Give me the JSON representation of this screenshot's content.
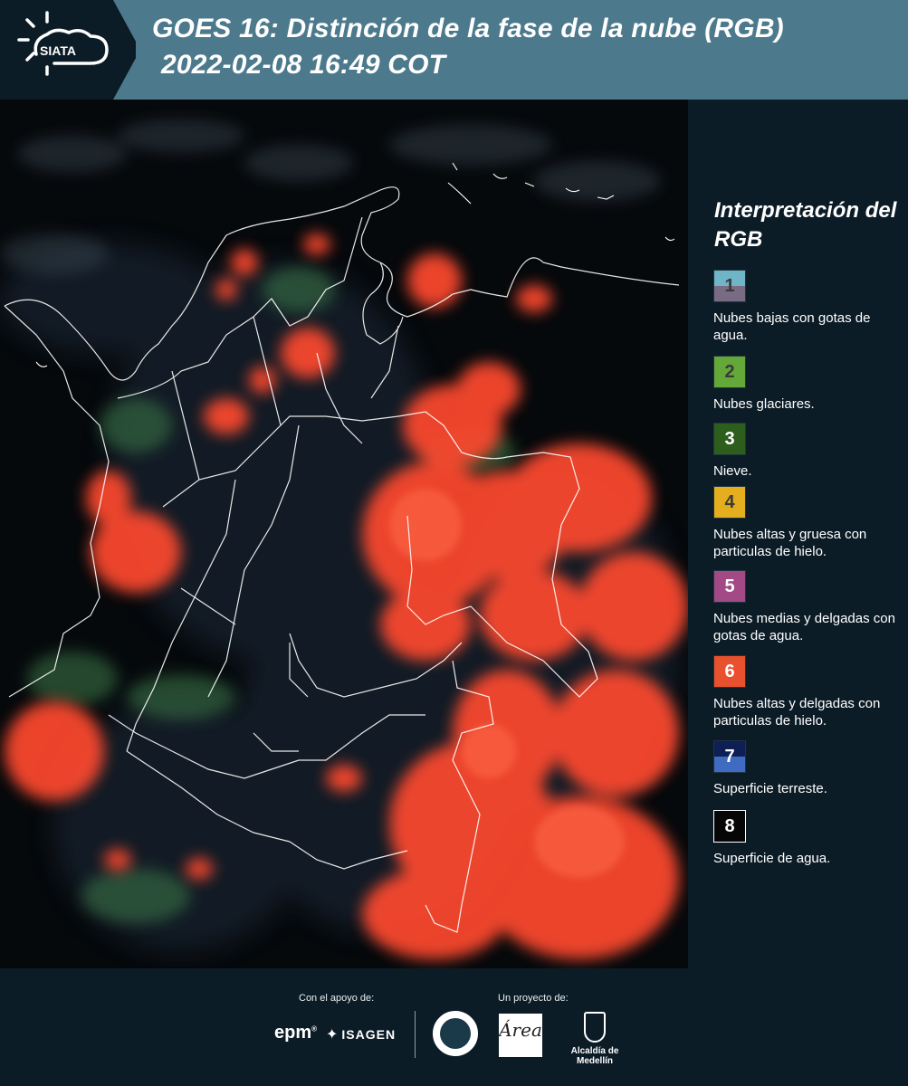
{
  "header": {
    "logo_text": "SIATA",
    "title_line1": "GOES 16: Distinción de la fase de la nube (RGB)",
    "title_line2": "2022-02-08 16:49 COT"
  },
  "legend": {
    "title": "Interpretación del RGB",
    "items": [
      {
        "number": "1",
        "label": "Nubes bajas con gotas de agua.",
        "color_top": "#6fb5c7",
        "color_bottom": "#7a6b85",
        "num_color": "#3a3a3a"
      },
      {
        "number": "2",
        "label": "Nubes glaciares.",
        "color_top": "#65a83a",
        "color_bottom": "#65a83a",
        "num_color": "#3a3a3a"
      },
      {
        "number": "3",
        "label": "Nieve.",
        "color_top": "#2d5e1e",
        "color_bottom": "#2d5e1e",
        "num_color": "#ffffff"
      },
      {
        "number": "4",
        "label": "Nubes altas y gruesa con particulas de hielo.",
        "color_top": "#e4ae1e",
        "color_bottom": "#e4ae1e",
        "num_color": "#3a3a3a"
      },
      {
        "number": "5",
        "label": "Nubes medias y delgadas con gotas de agua.",
        "color_top": "#a34a86",
        "color_bottom": "#a34a86",
        "num_color": "#ffffff"
      },
      {
        "number": "6",
        "label": "Nubes altas y delgadas con particulas de hielo.",
        "color_top": "#e9512e",
        "color_bottom": "#e9512e",
        "num_color": "#ffffff"
      },
      {
        "number": "7",
        "label": "Superficie terreste.",
        "color_top": "#0d1f55",
        "color_bottom": "#3f6cc0",
        "num_color": "#ffffff"
      },
      {
        "number": "8",
        "label": "Superficie de agua.",
        "color_top": "#060606",
        "color_bottom": "#060606",
        "num_color": "#ffffff"
      }
    ]
  },
  "footer": {
    "support_text": "Con el apoyo de:",
    "project_text": "Un proyecto de:",
    "logo_epm": "epm",
    "logo_isagen": "ISAGEN",
    "logo_area": "Área",
    "logo_alcaldia": "Alcaldía de Medellín"
  },
  "colors": {
    "header_bg": "#4c7a8c",
    "panel_bg": "#0c1c26",
    "cloud_red": "#ff4a2e",
    "border_white": "#ffffff"
  }
}
